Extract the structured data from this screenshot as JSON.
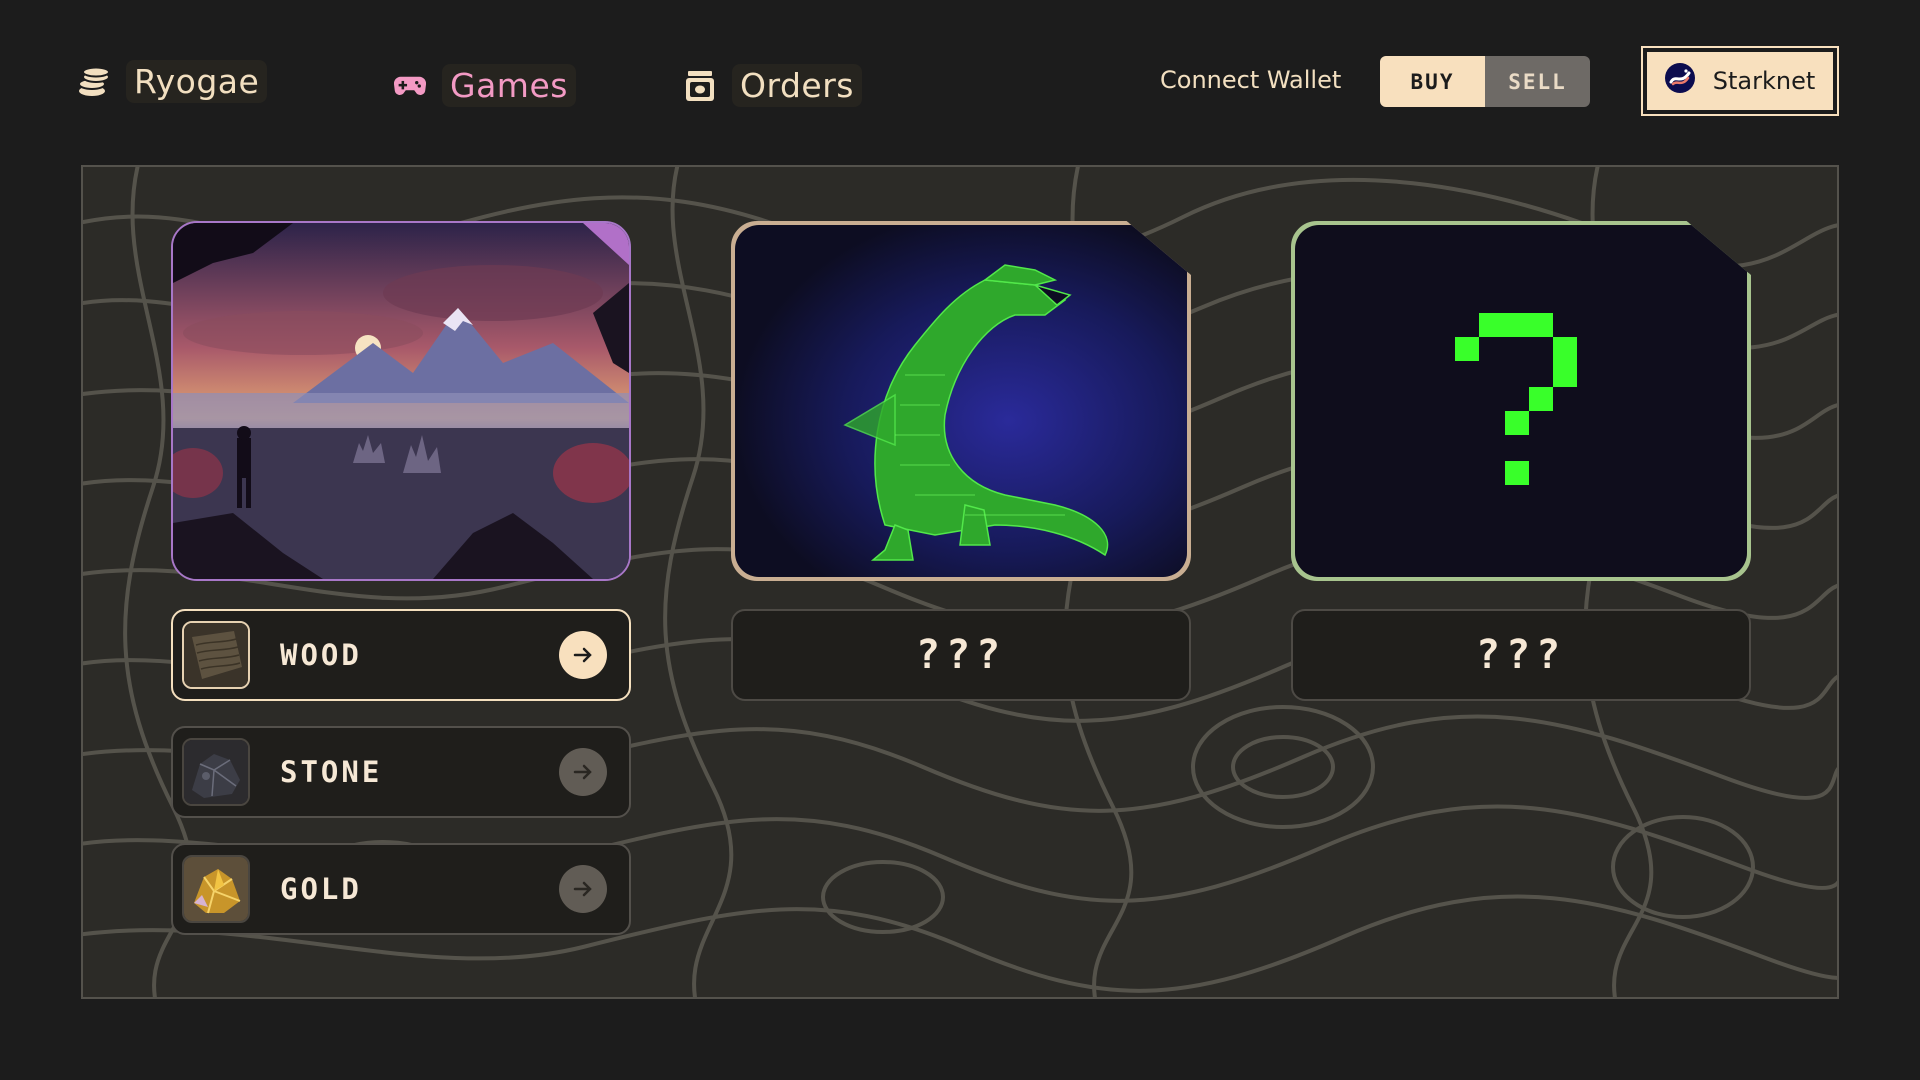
{
  "header": {
    "brand": {
      "label": "Ryogae",
      "icon": "coins-stack-icon"
    },
    "nav": [
      {
        "label": "Games",
        "icon": "gamepad-icon",
        "active": true
      },
      {
        "label": "Orders",
        "icon": "box-icon",
        "active": false
      }
    ],
    "connect_wallet_label": "Connect Wallet",
    "trade_toggle": {
      "buy_label": "BUY",
      "sell_label": "SELL",
      "selected": "BUY"
    },
    "network": {
      "label": "Starknet",
      "icon": "starknet-logo-icon"
    }
  },
  "games": [
    {
      "image": "mountain-landscape-image",
      "label": null,
      "unlocked": true
    },
    {
      "image": "green-dragon-image",
      "label": "???",
      "unlocked": false
    },
    {
      "image": "question-mark-image",
      "label": "???",
      "unlocked": false
    }
  ],
  "resources": [
    {
      "label": "WOOD",
      "thumbnail": "wood-thumbnail",
      "selected": true
    },
    {
      "label": "STONE",
      "thumbnail": "stone-thumbnail",
      "selected": false
    },
    {
      "label": "GOLD",
      "thumbnail": "gold-thumbnail",
      "selected": false
    }
  ],
  "colors": {
    "background": "#1c1c1c",
    "panel": "#2c2b27",
    "accent_cream": "#f8e0be",
    "active_nav_pink": "#f39ac4",
    "mystery_green": "#39ff2a"
  }
}
